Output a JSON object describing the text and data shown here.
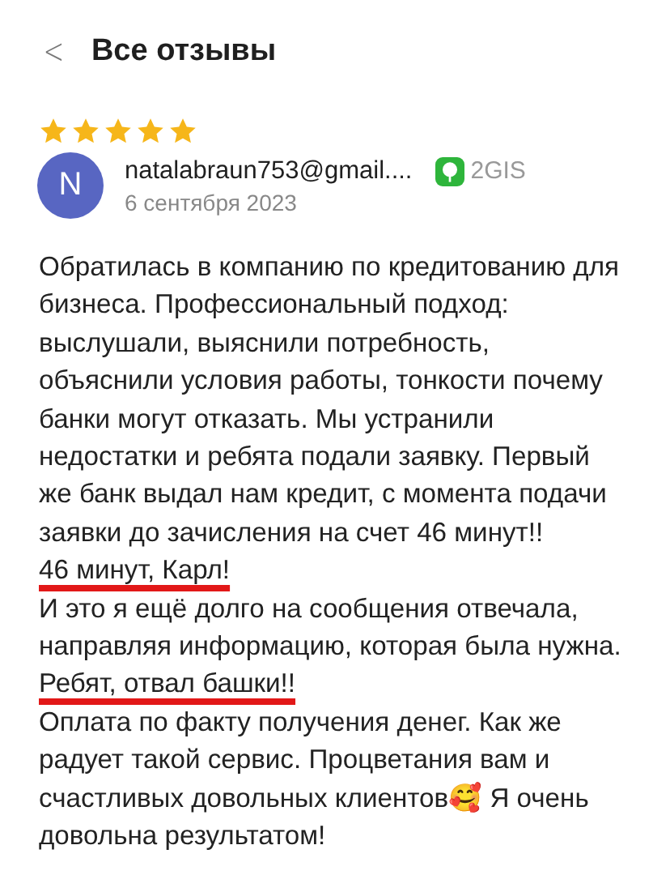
{
  "header": {
    "back": "<",
    "title": "Все отзывы"
  },
  "review": {
    "stars": 5,
    "avatar_letter": "N",
    "author": "natalabraun753@gmail....",
    "source": "2GIS",
    "date": "6 сентября 2023",
    "text": [
      {
        "text": "Обратилась в компанию по кредитованию для бизнеса. Профессиональный подход: выслушали, выяснили потребность, объяснили условия работы, тонкости почему банки могут отказать. Мы устранили недостатки и ребята подали заявку. Первый же банк выдал нам кредит, с момента подачи заявки до зачисления на счет 46 минут!!\n",
        "underlined": false
      },
      {
        "text": "46 минут, Карл!",
        "underlined": true
      },
      {
        "text": "\nИ это я ещё долго на сообщения отвечала, направляя информацию, которая была нужна.\n",
        "underlined": false
      },
      {
        "text": "Ребят, отвал башки!!",
        "underlined": true
      },
      {
        "text": "\nОплата по факту получения денег. Как же радует такой сервис. Процветания вам и счастливых довольных клиентов🥰 Я очень довольна результатом!",
        "underlined": false
      }
    ]
  }
}
